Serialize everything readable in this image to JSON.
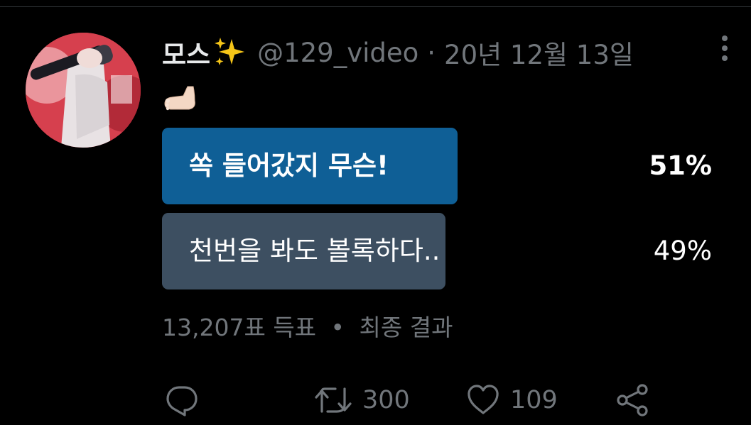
{
  "tweet": {
    "display_name": "모스",
    "name_emoji_icon": "sparkles-icon",
    "handle": "@129_video",
    "separator": "·",
    "timestamp": "20년 12월 13일",
    "text_emoji_icon": "foot-icon"
  },
  "poll": {
    "options": [
      {
        "label": "쏙 들어갔지 무슨!",
        "percent": "51%",
        "share": 0.51,
        "color": "#0f5f96",
        "leading": true
      },
      {
        "label": "천번을 봐도 볼록하다..",
        "percent": "49%",
        "share": 0.49,
        "color": "#3d4f61",
        "leading": false
      }
    ],
    "votes": "13,207표 득표",
    "bullet": "•",
    "status": "최종 결과"
  },
  "actions": {
    "reply_icon": "reply-icon",
    "retweet_icon": "retweet-icon",
    "retweet_count": "300",
    "like_icon": "heart-icon",
    "like_count": "109",
    "share_icon": "share-icon"
  },
  "colors": {
    "background": "#000000",
    "primary_text": "#e7e9ea",
    "secondary_text": "#71767b",
    "divider": "#2f3336"
  }
}
